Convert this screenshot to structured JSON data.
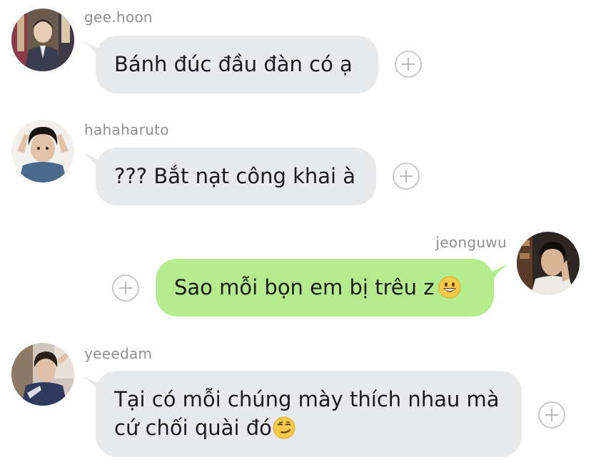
{
  "messages": [
    {
      "username": "gee.hoon",
      "text": "Bánh đúc đầu đàn có ạ",
      "avatar": "profile-photo-gee-hoon",
      "direction": "incoming"
    },
    {
      "username": "hahaharuto",
      "text": "??? Bắt nạt công khai à",
      "avatar": "profile-photo-hahaharuto",
      "direction": "incoming"
    },
    {
      "username": "jeonguwu",
      "text": "Sao mỗi bọn em bị trêu z",
      "emoji": "grinning-face-emoji",
      "avatar": "profile-photo-jeonguwu",
      "direction": "outgoing"
    },
    {
      "username": "yeeedam",
      "text_line1": "Tại có mỗi chúng mày thích nhau mà",
      "text_line2": "cứ chối quài đó",
      "emoji": "smirking-face-emoji",
      "avatar": "profile-photo-yeeedam",
      "direction": "incoming"
    }
  ],
  "colors": {
    "incoming_bubble": "#e8e9eb",
    "outgoing_bubble": "#b5ec8d",
    "username_text": "#8e8e93",
    "message_text": "#1c1c1e",
    "react_button": "#c8c8cc"
  },
  "react_button_icon": "plus-icon"
}
